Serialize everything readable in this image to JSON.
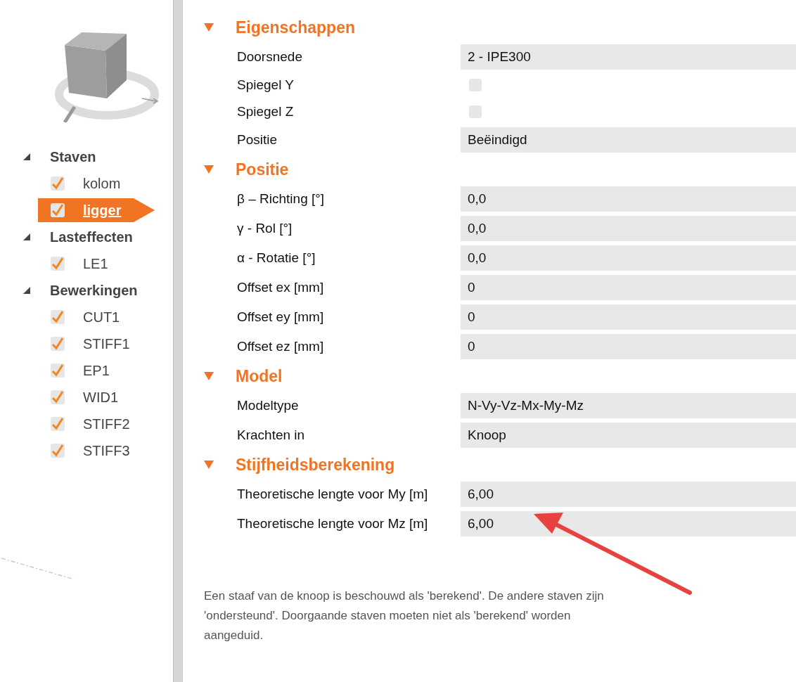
{
  "tree": [
    {
      "label": "Staven",
      "expanded": true,
      "children": [
        {
          "label": "kolom",
          "checked": true,
          "selected": false
        },
        {
          "label": "ligger",
          "checked": true,
          "selected": true
        }
      ]
    },
    {
      "label": "Lasteffecten",
      "expanded": true,
      "children": [
        {
          "label": "LE1",
          "checked": true,
          "selected": false
        }
      ]
    },
    {
      "label": "Bewerkingen",
      "expanded": true,
      "children": [
        {
          "label": "CUT1",
          "checked": true,
          "selected": false
        },
        {
          "label": "STIFF1",
          "checked": true,
          "selected": false
        },
        {
          "label": "EP1",
          "checked": true,
          "selected": false
        },
        {
          "label": "WID1",
          "checked": true,
          "selected": false
        },
        {
          "label": "STIFF2",
          "checked": true,
          "selected": false
        },
        {
          "label": "STIFF3",
          "checked": true,
          "selected": false
        }
      ]
    }
  ],
  "sections": [
    {
      "title": "Eigenschappen",
      "expanded": true,
      "rows": [
        {
          "kind": "text",
          "label": "Doorsnede",
          "value": "2 - IPE300"
        },
        {
          "kind": "checkbox",
          "label": "Spiegel Y",
          "checked": false
        },
        {
          "kind": "checkbox",
          "label": "Spiegel Z",
          "checked": false
        },
        {
          "kind": "text",
          "label": "Positie",
          "value": "Beëindigd"
        }
      ]
    },
    {
      "title": "Positie",
      "expanded": true,
      "rows": [
        {
          "kind": "text",
          "label": "β – Richting [°]",
          "value": "0,0"
        },
        {
          "kind": "text",
          "label": "γ - Rol [°]",
          "value": "0,0"
        },
        {
          "kind": "text",
          "label": "α - Rotatie [°]",
          "value": "0,0"
        },
        {
          "kind": "text",
          "label": "Offset ex [mm]",
          "value": "0"
        },
        {
          "kind": "text",
          "label": "Offset ey [mm]",
          "value": "0"
        },
        {
          "kind": "text",
          "label": "Offset ez [mm]",
          "value": "0"
        }
      ]
    },
    {
      "title": "Model",
      "expanded": true,
      "rows": [
        {
          "kind": "text",
          "label": "Modeltype",
          "value": "N-Vy-Vz-Mx-My-Mz"
        },
        {
          "kind": "text",
          "label": "Krachten in",
          "value": "Knoop"
        }
      ]
    },
    {
      "title": "Stijfheidsberekening",
      "expanded": true,
      "rows": [
        {
          "kind": "text",
          "label": "Theoretische lengte voor My [m]",
          "value": "6,00"
        },
        {
          "kind": "text",
          "label": "Theoretische lengte voor Mz [m]",
          "value": "6,00"
        }
      ]
    }
  ],
  "note": "Een staaf van de knoop is beschouwd als 'berekend'. De andere staven zijn 'ondersteund'. Doorgaande staven moeten niet als 'berekend' worden aangeduid."
}
